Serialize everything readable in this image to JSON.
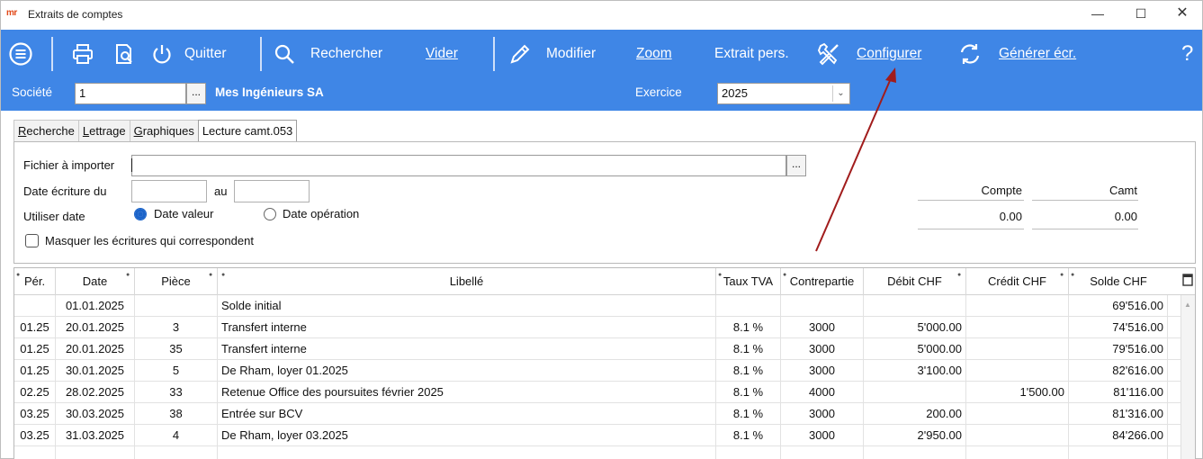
{
  "window": {
    "logo": "mr",
    "title": "Extraits de comptes",
    "minimize": "—",
    "maximize": "☐",
    "close": "✕"
  },
  "toolbar": {
    "quit": "Quitter",
    "search": "Rechercher",
    "clear": "Vider",
    "modify": "Modifier",
    "zoom": "Zoom",
    "extract": "Extrait pers.",
    "configure": "Configurer",
    "generate": "Générer écr.",
    "help": "?"
  },
  "company": {
    "label": "Société",
    "value": "1",
    "browse": "...",
    "name": "Mes Ingénieurs SA",
    "year_label": "Exercice",
    "year_value": "2025",
    "year_arrow": "⌄"
  },
  "tabs": [
    {
      "label": "Recherche",
      "underline": "R",
      "rest": "echerche"
    },
    {
      "label": "Lettrage",
      "underline": "L",
      "rest": "ettrage"
    },
    {
      "label": "Graphiques",
      "underline": "G",
      "rest": "raphiques"
    },
    {
      "label": "Lecture camt.053",
      "underline": "",
      "rest": "Lecture camt.053"
    }
  ],
  "panel": {
    "file_label": "Fichier à importer",
    "file_value": "",
    "browse": "...",
    "date_from_label": "Date écriture du",
    "date_to_label": "au",
    "use_date_label": "Utiliser date",
    "radio_value_date": "Date valeur",
    "radio_operation_date": "Date opération",
    "hide_matching": "Masquer les écritures qui correspondent",
    "summary": {
      "compte_label": "Compte",
      "camt_label": "Camt",
      "compte_value": "0.00",
      "camt_value": "0.00"
    }
  },
  "grid": {
    "columns": [
      "Pér.",
      "Date",
      "Pièce",
      "Libellé",
      "Taux TVA",
      "Contrepartie",
      "Débit CHF",
      "Crédit CHF",
      "Solde CHF"
    ],
    "rows": [
      {
        "per": "",
        "date": "01.01.2025",
        "piece": "",
        "libelle": "Solde initial",
        "tva": "",
        "contre": "",
        "debit": "",
        "credit": "",
        "solde": "69'516.00"
      },
      {
        "per": "01.25",
        "date": "20.01.2025",
        "piece": "3",
        "libelle": "Transfert interne",
        "tva": "8.1 %",
        "contre": "3000",
        "debit": "5'000.00",
        "credit": "",
        "solde": "74'516.00"
      },
      {
        "per": "01.25",
        "date": "20.01.2025",
        "piece": "35",
        "libelle": "Transfert interne",
        "tva": "8.1 %",
        "contre": "3000",
        "debit": "5'000.00",
        "credit": "",
        "solde": "79'516.00"
      },
      {
        "per": "01.25",
        "date": "30.01.2025",
        "piece": "5",
        "libelle": "De Rham, loyer 01.2025",
        "tva": "8.1 %",
        "contre": "3000",
        "debit": "3'100.00",
        "credit": "",
        "solde": "82'616.00"
      },
      {
        "per": "02.25",
        "date": "28.02.2025",
        "piece": "33",
        "libelle": "Retenue Office des poursuites février 2025",
        "tva": "8.1 %",
        "contre": "4000",
        "debit": "",
        "credit": "1'500.00",
        "solde": "81'116.00"
      },
      {
        "per": "03.25",
        "date": "30.03.2025",
        "piece": "38",
        "libelle": "Entrée sur BCV",
        "tva": "8.1 %",
        "contre": "3000",
        "debit": "200.00",
        "credit": "",
        "solde": "81'316.00"
      },
      {
        "per": "03.25",
        "date": "31.03.2025",
        "piece": "4",
        "libelle": "De Rham, loyer 03.2025",
        "tva": "8.1 %",
        "contre": "3000",
        "debit": "2'950.00",
        "credit": "",
        "solde": "84'266.00"
      }
    ]
  },
  "colors": {
    "toolbar": "#3f86e6",
    "annotation_arrow": "#a11c1c",
    "radio_accent": "#1b63c9"
  }
}
